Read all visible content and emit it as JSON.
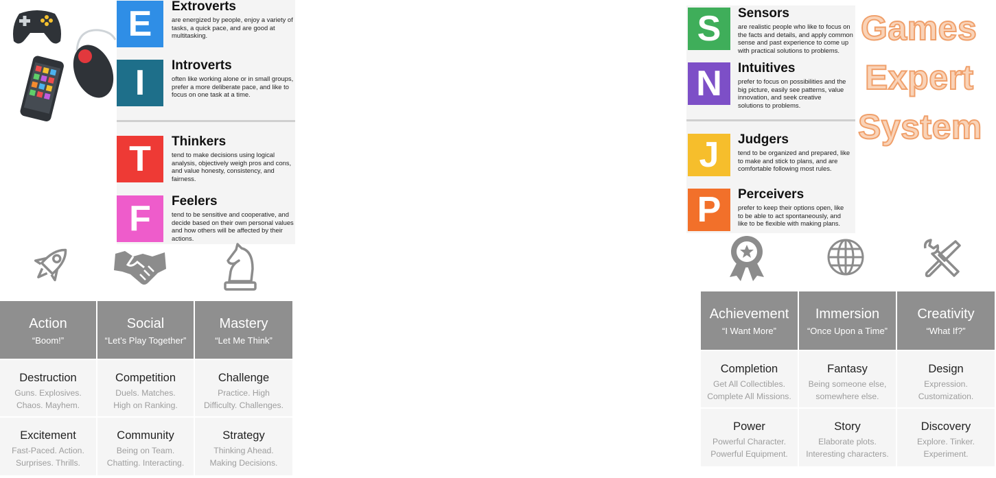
{
  "title": [
    "Games",
    "Expert",
    "System"
  ],
  "personality_left": [
    {
      "letter": "E",
      "name": "Extroverts",
      "desc": "are energized by people, enjoy a variety of tasks, a quick pace, and are good at multitasking.",
      "color": "#2f8ee6"
    },
    {
      "letter": "I",
      "name": "Introverts",
      "desc": "often like working alone or in small groups, prefer a more deliberate pace, and like to focus on one task at a time.",
      "color": "#1e6f8a"
    },
    {
      "letter": "T",
      "name": "Thinkers",
      "desc": "tend to make decisions using logical analysis, objectively weigh pros and cons, and value honesty, consistency, and fairness.",
      "color": "#ee3a35"
    },
    {
      "letter": "F",
      "name": "Feelers",
      "desc": "tend to be sensitive and cooperative, and decide based on their own personal values and how others will be affected by their actions.",
      "color": "#ee5ccb"
    }
  ],
  "personality_right": [
    {
      "letter": "S",
      "name": "Sensors",
      "desc": "are realistic people who like to focus on the facts and details, and apply common sense and past experience to come up with practical solutions to problems.",
      "color": "#3fae5a"
    },
    {
      "letter": "N",
      "name": "Intuitives",
      "desc": "prefer to focus on possibilities and the big picture, easily see patterns, value innovation, and seek creative solutions to problems.",
      "color": "#7d4fc7"
    },
    {
      "letter": "J",
      "name": "Judgers",
      "desc": "tend to be organized and prepared, like to make and stick to plans, and are comfortable following most rules.",
      "color": "#f6be2c"
    },
    {
      "letter": "P",
      "name": "Perceivers",
      "desc": "prefer to keep their options open, like to be able to act spontaneously, and like to be flexible with making plans.",
      "color": "#f2702a"
    }
  ],
  "motivations_left": {
    "icons": [
      "rocket-icon",
      "handshake-icon",
      "chess-knight-icon"
    ],
    "headers": [
      {
        "title": "Action",
        "quote": "“Boom!”"
      },
      {
        "title": "Social",
        "quote": "“Let’s Play Together”"
      },
      {
        "title": "Mastery",
        "quote": "“Let Me Think”"
      }
    ],
    "rows": [
      [
        {
          "title": "Destruction",
          "lines": [
            "Guns. Explosives.",
            "Chaos. Mayhem."
          ]
        },
        {
          "title": "Competition",
          "lines": [
            "Duels. Matches.",
            "High on Ranking."
          ]
        },
        {
          "title": "Challenge",
          "lines": [
            "Practice. High",
            "Difficulty. Challenges."
          ]
        }
      ],
      [
        {
          "title": "Excitement",
          "lines": [
            "Fast-Paced. Action.",
            "Surprises. Thrills."
          ]
        },
        {
          "title": "Community",
          "lines": [
            "Being on Team.",
            "Chatting. Interacting."
          ]
        },
        {
          "title": "Strategy",
          "lines": [
            "Thinking Ahead.",
            "Making Decisions."
          ]
        }
      ]
    ]
  },
  "motivations_right": {
    "icons": [
      "award-ribbon-icon",
      "globe-icon",
      "tools-icon"
    ],
    "headers": [
      {
        "title": "Achievement",
        "quote": "“I Want More”"
      },
      {
        "title": "Immersion",
        "quote": "“Once Upon a Time”"
      },
      {
        "title": "Creativity",
        "quote": "“What If?”"
      }
    ],
    "rows": [
      [
        {
          "title": "Completion",
          "lines": [
            "Get All Collectibles.",
            "Complete All Missions."
          ]
        },
        {
          "title": "Fantasy",
          "lines": [
            "Being someone else,",
            "somewhere else."
          ]
        },
        {
          "title": "Design",
          "lines": [
            "Expression.",
            "Customization."
          ]
        }
      ],
      [
        {
          "title": "Power",
          "lines": [
            "Powerful Character.",
            "Powerful Equipment."
          ]
        },
        {
          "title": "Story",
          "lines": [
            "Elaborate plots.",
            "Interesting characters."
          ]
        },
        {
          "title": "Discovery",
          "lines": [
            "Explore. Tinker.",
            "Experiment."
          ]
        }
      ]
    ]
  }
}
